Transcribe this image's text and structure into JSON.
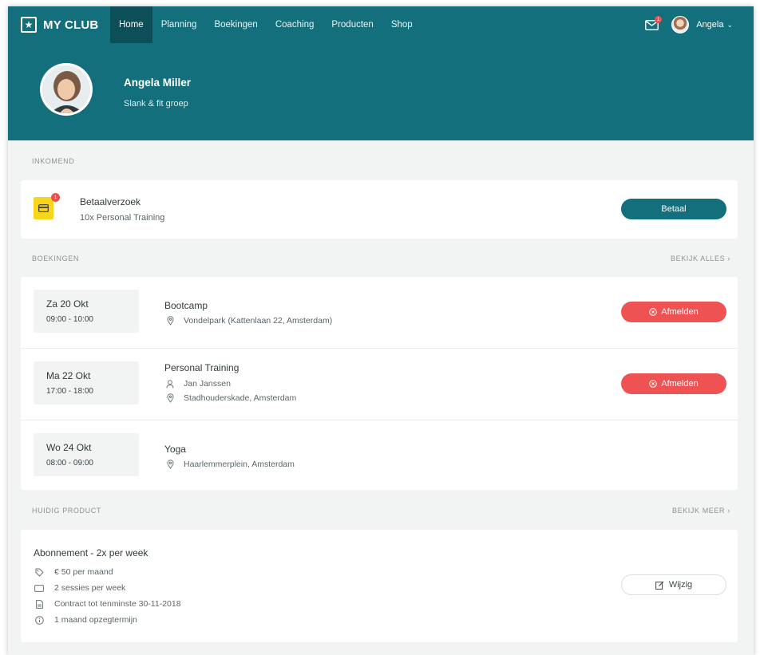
{
  "colors": {
    "brand": "#126f7b",
    "nav_active": "#0c4f58",
    "danger": "#ee5252",
    "pay_icon": "#f7d51d",
    "badge": "#ef4e4e"
  },
  "app": {
    "logo_icon": "star-icon",
    "name": "MY CLUB"
  },
  "nav": {
    "items": [
      {
        "label": "Home",
        "active": true
      },
      {
        "label": "Planning"
      },
      {
        "label": "Boekingen"
      },
      {
        "label": "Coaching"
      },
      {
        "label": "Producten"
      },
      {
        "label": "Shop"
      }
    ],
    "mail_badge": "1",
    "user": "Angela"
  },
  "profile": {
    "name": "Angela Miller",
    "group": "Slank & fit groep"
  },
  "incoming": {
    "label": "INKOMEND",
    "item": {
      "title": "Betaalverzoek",
      "description": "10x Personal Training",
      "icon": "payment-card-icon",
      "badge": "1",
      "button": "Betaal"
    }
  },
  "bookings": {
    "label": "BOEKINGEN",
    "link": "BEKIJK ALLES ›",
    "items": [
      {
        "day": "Za 20 Okt",
        "time": "09:00 - 10:00",
        "title": "Bootcamp",
        "trainer": "",
        "location": "Vondelpark (Kattenlaan 22, Amsterdam)",
        "button": "Afmelden"
      },
      {
        "day": "Ma 22 Okt",
        "time": "17:00 - 18:00",
        "title": "Personal Training",
        "trainer": "Jan Janssen",
        "location": "Stadhouderskade, Amsterdam",
        "button": "Afmelden"
      },
      {
        "day": "Wo 24 Okt",
        "time": "08:00 - 09:00",
        "title": "Yoga",
        "trainer": "",
        "location": "Haarlemmerplein, Amsterdam",
        "button": ""
      }
    ]
  },
  "product": {
    "label": "HUIDIG PRODUCT",
    "link": "BEKIJK MEER ›",
    "title": "Abonnement - 2x per week",
    "price": "€ 50 per maand",
    "sessions": "2 sessies per week",
    "contract": "Contract tot tenminste 30-11-2018",
    "notice": "1 maand opzegtermijn",
    "button": "Wijzig"
  }
}
